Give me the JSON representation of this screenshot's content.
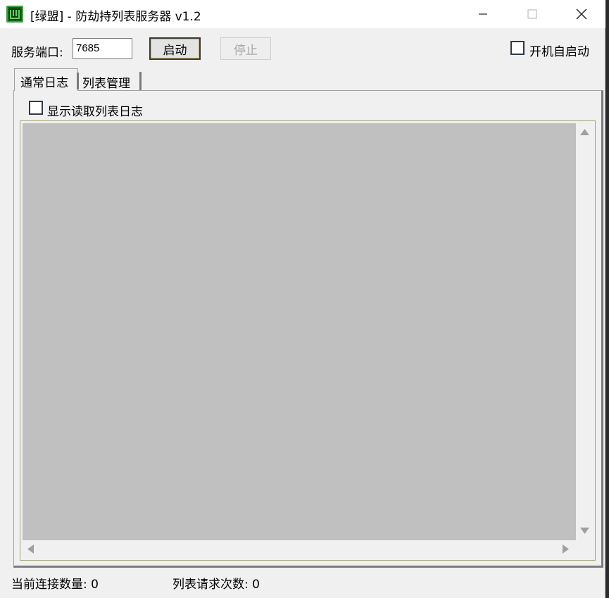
{
  "window": {
    "title": "[绿盟] - 防劫持列表服务器 v1.2"
  },
  "toolbar": {
    "port_label": "服务端口:",
    "port_value": "7685",
    "start_label": "启动",
    "stop_label": "停止",
    "autostart_label": "开机自启动",
    "autostart_checked": false
  },
  "tabs": [
    {
      "label": "通常日志",
      "active": true
    },
    {
      "label": "列表管理",
      "active": false
    }
  ],
  "log_panel": {
    "show_read_list_log_label": "显示读取列表日志",
    "show_read_list_log_checked": false
  },
  "status_bar": {
    "connections": "当前连接数量: 0",
    "list_requests": "列表请求次数: 0"
  },
  "colors": {
    "log_background": "#c0c0c0",
    "window_background": "#f0f0f0",
    "icon_green": "#1f5f1f"
  }
}
